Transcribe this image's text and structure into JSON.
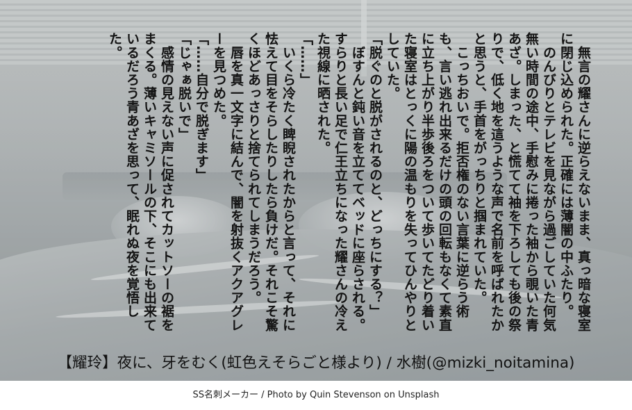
{
  "story": {
    "paragraphs": [
      "　無言の耀さんに逆らえないまま、真っ暗な寝室に閉じ込められた。正確には薄闇の中ふたり。",
      "　のんびりとテレビを見ながら過ごしていた何気無い時間の途中、手慰みに捲った袖から覗いた青あざ。しまった、と慌てて袖を下ろしても後の祭りで、低く地を這うような声で名前を呼ばれたかと思うと、手首をがっちりと掴まれていた。",
      "　こっちおいで。拒否権のない言葉に逆らう術も、言い逃れ出来るだけの頭の回転もなくて素直に立ち上がり半歩後ろをついて歩いてたどり着いた寝室はとっくに陽の温もりを失ってひんやりとしていた。",
      "「脱ぐのと脱がされるのと、どっちにする？」",
      "　ぼすんと鈍い音を立ててベッドに座らされる。すらりと長い足で仁王立ちになった耀さんの冷えた視線に晒された。",
      "「……」",
      "　いくら冷たく睥睨されたからと言って、それに怯えて目をそらしたりしたら負けだ。それこそ驚くほどあっさりと捨てられてしまうだろう。",
      "　唇を真一文字に結んで、闇を射抜くアクアグレーを見つめた。",
      "「……自分で脱ぎます」",
      "「じゃぁ脱いで」",
      "　感情の見えない声に促されてカットソーの裾をまくる。薄いキャミソールの下、そこにも出来ているだろう青あざを思って、眠れぬ夜を覚悟した。"
    ]
  },
  "caption": "【耀玲】夜に、牙をむく(虹色えそらごと様より) / 水樹(@mizki_noitamina)",
  "footer": "SS名刺メーカー / Photo by Quin Stevenson on Unsplash"
}
